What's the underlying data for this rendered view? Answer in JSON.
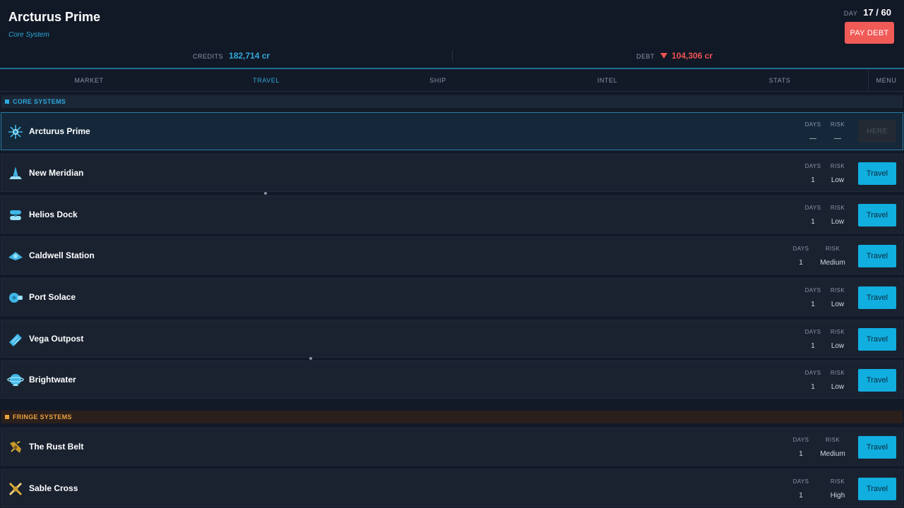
{
  "location": {
    "name": "Arcturus Prime",
    "subtitle": "Core System"
  },
  "day": {
    "label": "DAY",
    "value": "17 / 60"
  },
  "pay_debt_label": "PAY DEBT",
  "credits": {
    "label": "CREDITS",
    "value": "182,714 cr"
  },
  "debt": {
    "label": "DEBT",
    "value": "104,306 cr"
  },
  "tabs": [
    {
      "label": "MARKET",
      "active": false
    },
    {
      "label": "TRAVEL",
      "active": true
    },
    {
      "label": "SHIP",
      "active": false
    },
    {
      "label": "INTEL",
      "active": false
    },
    {
      "label": "STATS",
      "active": false
    },
    {
      "label": "MENU",
      "active": false
    }
  ],
  "sections": {
    "core": {
      "title": "CORE SYSTEMS"
    },
    "fringe": {
      "title": "FRINGE SYSTEMS"
    }
  },
  "column_labels": {
    "days": "DAYS",
    "risk": "RISK"
  },
  "rows": [
    {
      "name": "Arcturus Prime",
      "icon": "arcturus-station-icon",
      "days": "—",
      "risk": "—",
      "action": "HERE",
      "current": true
    },
    {
      "name": "New Meridian",
      "icon": "meridian-station-icon",
      "days": "1",
      "risk": "Low",
      "action": "Travel"
    },
    {
      "name": "Helios Dock",
      "icon": "helios-station-icon",
      "days": "1",
      "risk": "Low",
      "action": "Travel"
    },
    {
      "name": "Caldwell Station",
      "icon": "caldwell-station-icon",
      "days": "1",
      "risk": "Medium",
      "action": "Travel"
    },
    {
      "name": "Port Solace",
      "icon": "solace-station-icon",
      "days": "1",
      "risk": "Low",
      "action": "Travel"
    },
    {
      "name": "Vega Outpost",
      "icon": "vega-station-icon",
      "days": "1",
      "risk": "Low",
      "action": "Travel"
    },
    {
      "name": "Brightwater",
      "icon": "brightwater-station-icon",
      "days": "1",
      "risk": "Low",
      "action": "Travel"
    },
    {
      "name": "The Rust Belt",
      "icon": "rust-belt-station-icon",
      "days": "1",
      "risk": "Medium",
      "action": "Travel"
    },
    {
      "name": "Sable Cross",
      "icon": "sable-cross-station-icon",
      "days": "1",
      "risk": "High",
      "action": "Travel"
    }
  ],
  "colors": {
    "accent": "#11aee0",
    "debt": "#ef5350",
    "core_icon": "#3fb6e6",
    "fringe_icon": "#e0b23a"
  }
}
